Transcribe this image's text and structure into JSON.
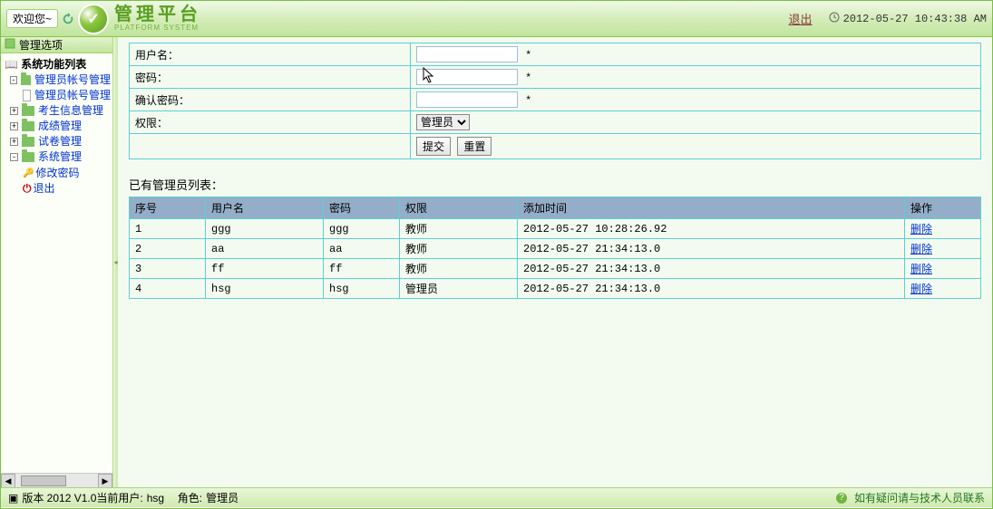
{
  "header": {
    "welcome": "欢迎您~",
    "brand_title": "管理平台",
    "brand_sub": "PLATFORM SYSTEM",
    "logout": "退出",
    "datetime": "2012-05-27 10:43:38 AM"
  },
  "sidebar": {
    "options_title": "管理选项",
    "tree_title": "系统功能列表",
    "items": [
      {
        "label": "管理员帐号管理",
        "type": "folder",
        "expanded": true,
        "link": true
      },
      {
        "label": "管理员帐号管理",
        "type": "page",
        "indent": 2,
        "link": true
      },
      {
        "label": "考生信息管理",
        "type": "folder",
        "link": true
      },
      {
        "label": "成绩管理",
        "type": "folder",
        "link": true
      },
      {
        "label": "试卷管理",
        "type": "folder",
        "link": true
      },
      {
        "label": "系统管理",
        "type": "folder",
        "expanded": true,
        "link": true
      },
      {
        "label": "修改密码",
        "type": "key",
        "indent": 2,
        "link": true
      },
      {
        "label": "退出",
        "type": "exit",
        "indent": 2,
        "link": true
      }
    ]
  },
  "form": {
    "labels": {
      "username": "用户名：",
      "password": "密码：",
      "confirm": "确认密码：",
      "role": "权限："
    },
    "role_value": "管理员",
    "required_mark": "*",
    "submit": "提交",
    "reset": "重置"
  },
  "list": {
    "title": "已有管理员列表：",
    "columns": [
      "序号",
      "用户名",
      "密码",
      "权限",
      "添加时间",
      "操作"
    ],
    "action_label": "删除",
    "rows": [
      {
        "seq": "1",
        "user": "ggg",
        "pwd": "ggg",
        "role": "教师",
        "time": "2012-05-27 10:28:26.92"
      },
      {
        "seq": "2",
        "user": "aa",
        "pwd": "aa",
        "role": "教师",
        "time": "2012-05-27 21:34:13.0"
      },
      {
        "seq": "3",
        "user": "ff",
        "pwd": "ff",
        "role": "教师",
        "time": "2012-05-27 21:34:13.0"
      },
      {
        "seq": "4",
        "user": "hsg",
        "pwd": "hsg",
        "role": "管理员",
        "time": "2012-05-27 21:34:13.0"
      }
    ]
  },
  "footer": {
    "version": "版本 2012 V1.0",
    "current_user_prefix": "当前用户:",
    "current_user": "hsg",
    "role_prefix": "角色:",
    "role": "管理员",
    "help": "如有疑问请与技术人员联系"
  }
}
